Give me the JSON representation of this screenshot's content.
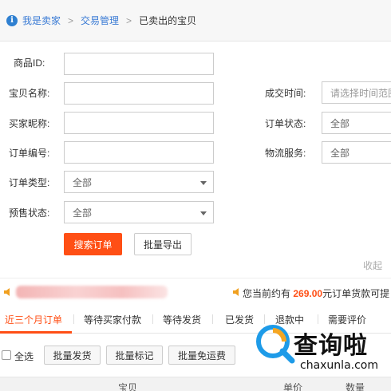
{
  "breadcrumb": {
    "items": [
      "我是卖家",
      "交易管理"
    ],
    "separator": ">",
    "current": "已卖出的宝贝"
  },
  "form": {
    "product_id_label": "商品ID:",
    "product_id_value": "",
    "title_label": "宝贝名称:",
    "title_value": "",
    "buyer_label": "买家昵称:",
    "buyer_value": "",
    "order_no_label": "订单编号:",
    "order_no_value": "",
    "order_type_label": "订单类型:",
    "order_type_value": "全部",
    "presale_label": "预售状态:",
    "presale_value": "全部",
    "deal_time_label": "成交时间:",
    "deal_time_placeholder": "请选择时间范围",
    "order_status_label": "订单状态:",
    "order_status_value": "全部",
    "logistics_label": "物流服务:",
    "logistics_value": "全部",
    "search_button": "搜索订单",
    "export_button": "批量导出",
    "collapse_link": "收起"
  },
  "notice": {
    "prefix": "您当前约有",
    "amount": "269.00",
    "suffix": "元订单货款可提"
  },
  "tabs": [
    "近三个月订单",
    "等待买家付款",
    "等待发货",
    "已发货",
    "退款中",
    "需要评价"
  ],
  "actions": {
    "select_all": "全选",
    "batch_ship": "批量发货",
    "batch_mark": "批量标记",
    "batch_free_shipping": "批量免运费"
  },
  "table_headers": [
    "宝贝",
    "单价",
    "数量"
  ],
  "watermark": {
    "text": "查询啦",
    "sub": "chaxunla.com"
  },
  "colors": {
    "accent": "#ff4f15",
    "link": "#3a7bd5",
    "info_icon": "#2f80d1"
  }
}
